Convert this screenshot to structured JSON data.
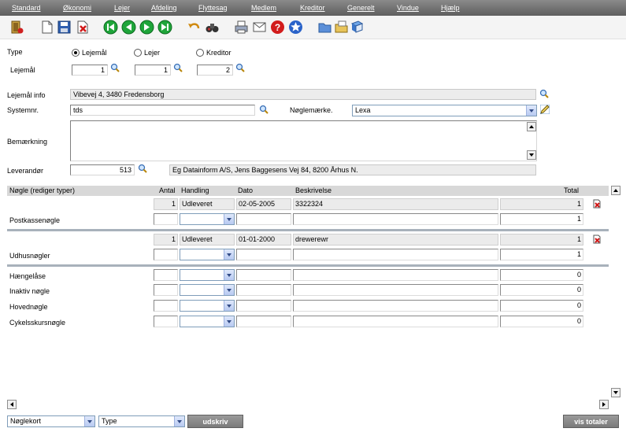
{
  "menu": [
    "Standard",
    "Økonomi",
    "Lejer",
    "Afdeling",
    "Flyttesag",
    "Medlem",
    "Kreditor",
    "Generelt",
    "Vindue",
    "Hjælp"
  ],
  "toolbar_icons": [
    "exit-icon",
    "new-icon",
    "save-icon",
    "delete-icon",
    "first-icon",
    "previous-icon",
    "next-icon",
    "last-icon",
    "undo-icon",
    "binoculars-icon",
    "print-icon",
    "mail-icon",
    "help-icon",
    "info-icon",
    "folder-open-icon",
    "folder-icon",
    "book-icon"
  ],
  "type": {
    "label": "Type",
    "options": [
      "Lejemål",
      "Lejer",
      "Kreditor"
    ],
    "selected": "Lejemål"
  },
  "lejemaal": {
    "label": "Lejemål",
    "values": [
      "1",
      "1",
      "2"
    ]
  },
  "lejemaal_info": {
    "label": "Lejemål info",
    "value": "Vibevej 4, 3480  Fredensborg"
  },
  "systemnr": {
    "label": "Systemnr.",
    "value": "tds"
  },
  "noglemaerke": {
    "label": "Nøglemærke.",
    "value": "Lexa"
  },
  "bemaerkning": {
    "label": "Bemærkning",
    "value": ""
  },
  "leverandor": {
    "label": "Leverandør",
    "number": "513",
    "name": "Eg Datainform A/S, Jens Baggesens Vej 84, 8200 Århus N."
  },
  "grid": {
    "headers": {
      "key": "Nøgle   (rediger typer)",
      "antal": "Antal",
      "handling": "Handling",
      "dato": "Dato",
      "beskrivelse": "Beskrivelse",
      "total": "Total"
    },
    "groups": [
      {
        "label": "Postkassenøgle",
        "entry": {
          "antal": "1",
          "handling": "Udleveret",
          "dato": "02-05-2005",
          "beskrivelse": "3322324",
          "total": "1"
        },
        "total": "1"
      },
      {
        "label": "Udhusnøgler",
        "entry": {
          "antal": "1",
          "handling": "Udleveret",
          "dato": "01-01-2000",
          "beskrivelse": "drewerewr",
          "total": "1"
        },
        "total": "1"
      }
    ],
    "empty_rows": [
      {
        "label": "Hængelåse",
        "total": "0"
      },
      {
        "label": "Inaktiv nøgle",
        "total": "0"
      },
      {
        "label": "Hovednøgle",
        "total": "0"
      },
      {
        "label": "Cykelsskursnøgle",
        "total": "0"
      }
    ]
  },
  "bottom": {
    "report_select": "Nøglekort",
    "type_select": "Type",
    "print_button": "udskriv",
    "totals_button": "vis totaler"
  },
  "colors": {
    "menubar": "#6e6e6e",
    "grid_header": "#d8d8d8",
    "separator": "#a8b1bb",
    "button": "#8a8a8a"
  }
}
